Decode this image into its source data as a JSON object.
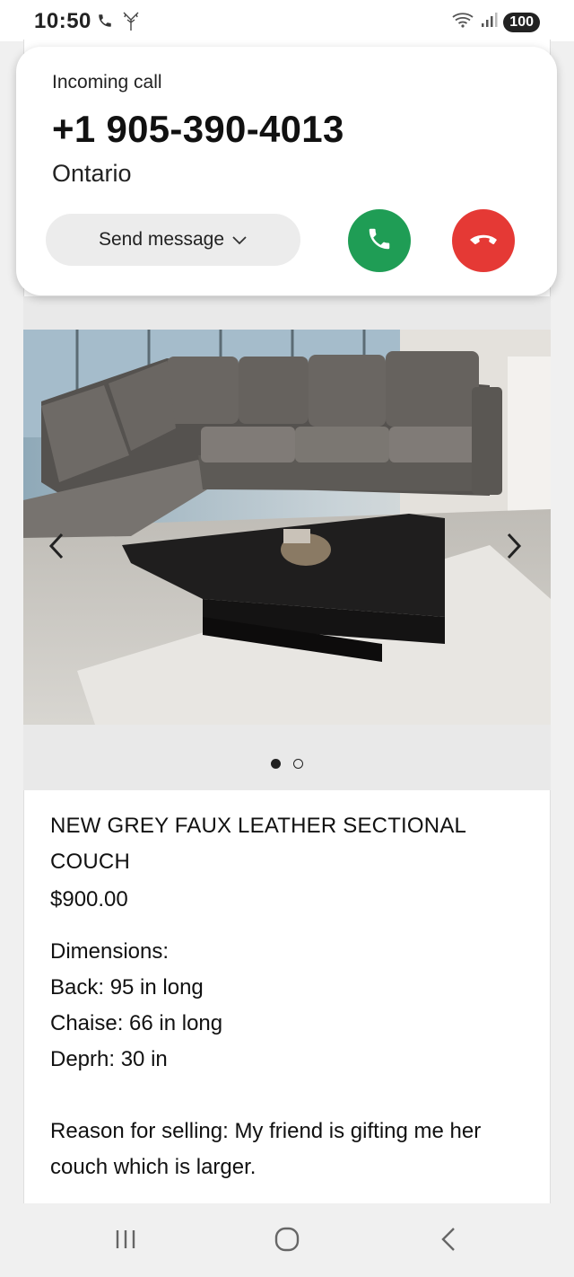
{
  "status_bar": {
    "time": "10:50",
    "left_icons": [
      "phone-icon",
      "tree-icon"
    ],
    "right_icons": [
      "wifi-icon",
      "signal-icon"
    ],
    "battery": "100"
  },
  "call": {
    "label": "Incoming call",
    "number": "+1 905-390-4013",
    "location": "Ontario",
    "send_message_label": "Send message",
    "accept_color": "#1f9d55",
    "decline_color": "#e53935"
  },
  "gallery": {
    "slide_count": 2,
    "active_slide": 1
  },
  "listing": {
    "title": "NEW GREY FAUX LEATHER SECTIONAL COUCH",
    "price": "$900.00",
    "description_lines": [
      "Dimensions:",
      "Back: 95 in long",
      "Chaise: 66 in long",
      "Deprh: 30 in"
    ],
    "reason": "Reason for selling: My friend is gifting me her couch which is larger."
  },
  "nav": {
    "icons": [
      "recent-apps-icon",
      "home-icon",
      "back-icon"
    ]
  }
}
